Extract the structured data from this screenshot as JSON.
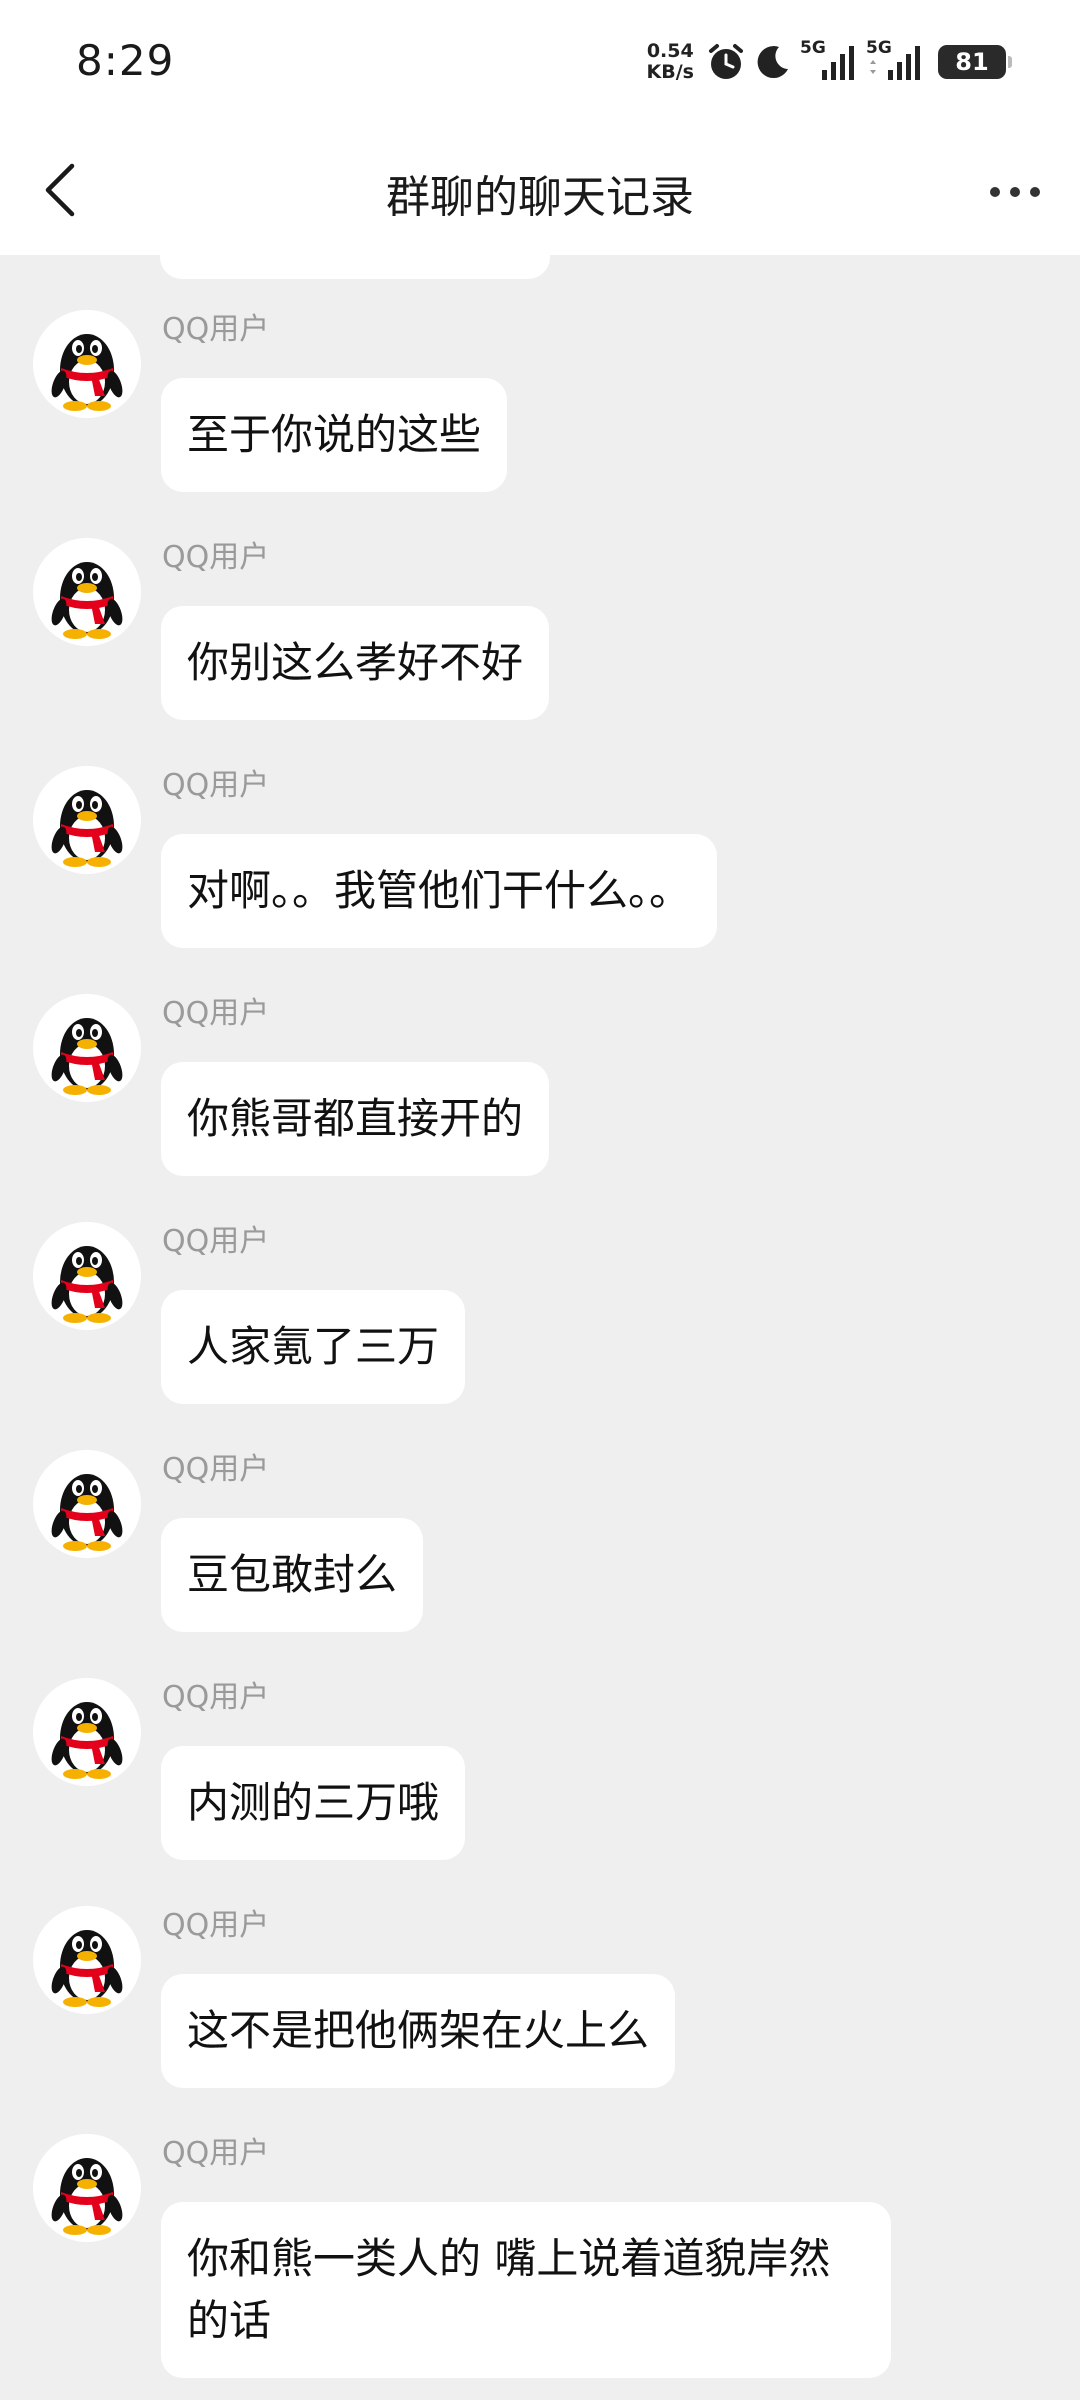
{
  "status": {
    "time": "8:29",
    "speed_value": "0.54",
    "speed_unit": "KB/s",
    "signal1_label": "5G",
    "signal2_label": "5G",
    "battery": "81"
  },
  "header": {
    "title": "群聊的聊天记录"
  },
  "messages": [
    {
      "sender": "QQ用户",
      "text": "至于你说的这些"
    },
    {
      "sender": "QQ用户",
      "text": "你别这么孝好不好"
    },
    {
      "sender": "QQ用户",
      "text": "对啊。。我管他们干什么。。"
    },
    {
      "sender": "QQ用户",
      "text": "你熊哥都直接开的"
    },
    {
      "sender": "QQ用户",
      "text": "人家氪了三万"
    },
    {
      "sender": "QQ用户",
      "text": "豆包敢封么"
    },
    {
      "sender": "QQ用户",
      "text": "内测的三万哦"
    },
    {
      "sender": "QQ用户",
      "text": "这不是把他俩架在火上么"
    },
    {
      "sender": "QQ用户",
      "text": "你和熊一类人的 嘴上说着道貌岸然的话"
    }
  ],
  "colors": {
    "background": "#efeff0",
    "bubble": "#ffffff",
    "sender_name": "#9a9a9a"
  }
}
